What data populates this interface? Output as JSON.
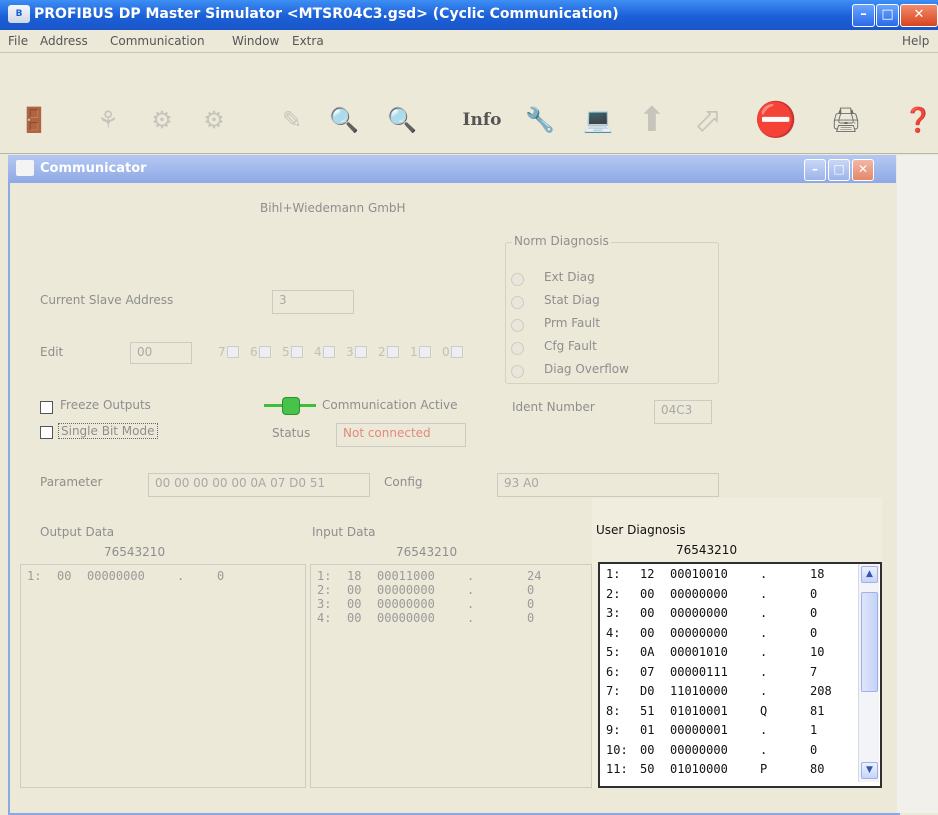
{
  "app": {
    "title": "PROFIBUS DP Master Simulator <MTSR04C3.gsd> (Cyclic Communication)",
    "icon_text": "B"
  },
  "menu": {
    "file": "File",
    "address": "Address",
    "communication": "Communication",
    "window": "Window",
    "extra": "Extra",
    "help": "Help"
  },
  "toolbar": {
    "info_label": "Info"
  },
  "communicator": {
    "title": "Communicator",
    "vendor": "Bihl+Wiedemann GmbH",
    "current_slave_address_label": "Current Slave Address",
    "current_slave_address_value": "3",
    "edit_label": "Edit",
    "edit_value": "00",
    "bits": [
      "7",
      "6",
      "5",
      "4",
      "3",
      "2",
      "1",
      "0"
    ],
    "freeze_outputs_label": "Freeze Outputs",
    "single_bit_mode_label": "Single Bit Mode",
    "communication_active_label": "Communication Active",
    "status_label": "Status",
    "status_value": "Not connected",
    "norm_diagnosis": {
      "title": "Norm Diagnosis",
      "items": [
        "Ext Diag",
        "Stat Diag",
        "Prm Fault",
        "Cfg Fault",
        "Diag Overflow"
      ],
      "ident_number_label": "Ident Number",
      "ident_number_value": "04C3"
    },
    "parameter_label": "Parameter",
    "parameter_value": "00 00 00 00 00 0A 07 D0 51",
    "config_label": "Config",
    "config_value": "93 A0",
    "output_data": {
      "title": "Output Data",
      "bit_header": "76543210",
      "rows": [
        {
          "idx": "1:",
          "hex": "00",
          "bin": "00000000",
          "chr": ".",
          "dec": "0"
        }
      ]
    },
    "input_data": {
      "title": "Input Data",
      "bit_header": "76543210",
      "rows": [
        {
          "idx": "1:",
          "hex": "18",
          "bin": "00011000",
          "chr": ".",
          "dec": "24"
        },
        {
          "idx": "2:",
          "hex": "00",
          "bin": "00000000",
          "chr": ".",
          "dec": "0"
        },
        {
          "idx": "3:",
          "hex": "00",
          "bin": "00000000",
          "chr": ".",
          "dec": "0"
        },
        {
          "idx": "4:",
          "hex": "00",
          "bin": "00000000",
          "chr": ".",
          "dec": "0"
        }
      ]
    },
    "user_diagnosis": {
      "title": "User Diagnosis",
      "bit_header": "76543210",
      "rows": [
        {
          "idx": "1:",
          "hex": "12",
          "bin": "00010010",
          "chr": ".",
          "dec": "18"
        },
        {
          "idx": "2:",
          "hex": "00",
          "bin": "00000000",
          "chr": ".",
          "dec": "0"
        },
        {
          "idx": "3:",
          "hex": "00",
          "bin": "00000000",
          "chr": ".",
          "dec": "0"
        },
        {
          "idx": "4:",
          "hex": "00",
          "bin": "00000000",
          "chr": ".",
          "dec": "0"
        },
        {
          "idx": "5:",
          "hex": "0A",
          "bin": "00001010",
          "chr": ".",
          "dec": "10"
        },
        {
          "idx": "6:",
          "hex": "07",
          "bin": "00000111",
          "chr": ".",
          "dec": "7"
        },
        {
          "idx": "7:",
          "hex": "D0",
          "bin": "11010000",
          "chr": ".",
          "dec": "208"
        },
        {
          "idx": "8:",
          "hex": "51",
          "bin": "01010001",
          "chr": "Q",
          "dec": "81"
        },
        {
          "idx": "9:",
          "hex": "01",
          "bin": "00000001",
          "chr": ".",
          "dec": "1"
        },
        {
          "idx": "10:",
          "hex": "00",
          "bin": "00000000",
          "chr": ".",
          "dec": "0"
        },
        {
          "idx": "11:",
          "hex": "50",
          "bin": "01010000",
          "chr": "P",
          "dec": "80"
        }
      ]
    }
  }
}
